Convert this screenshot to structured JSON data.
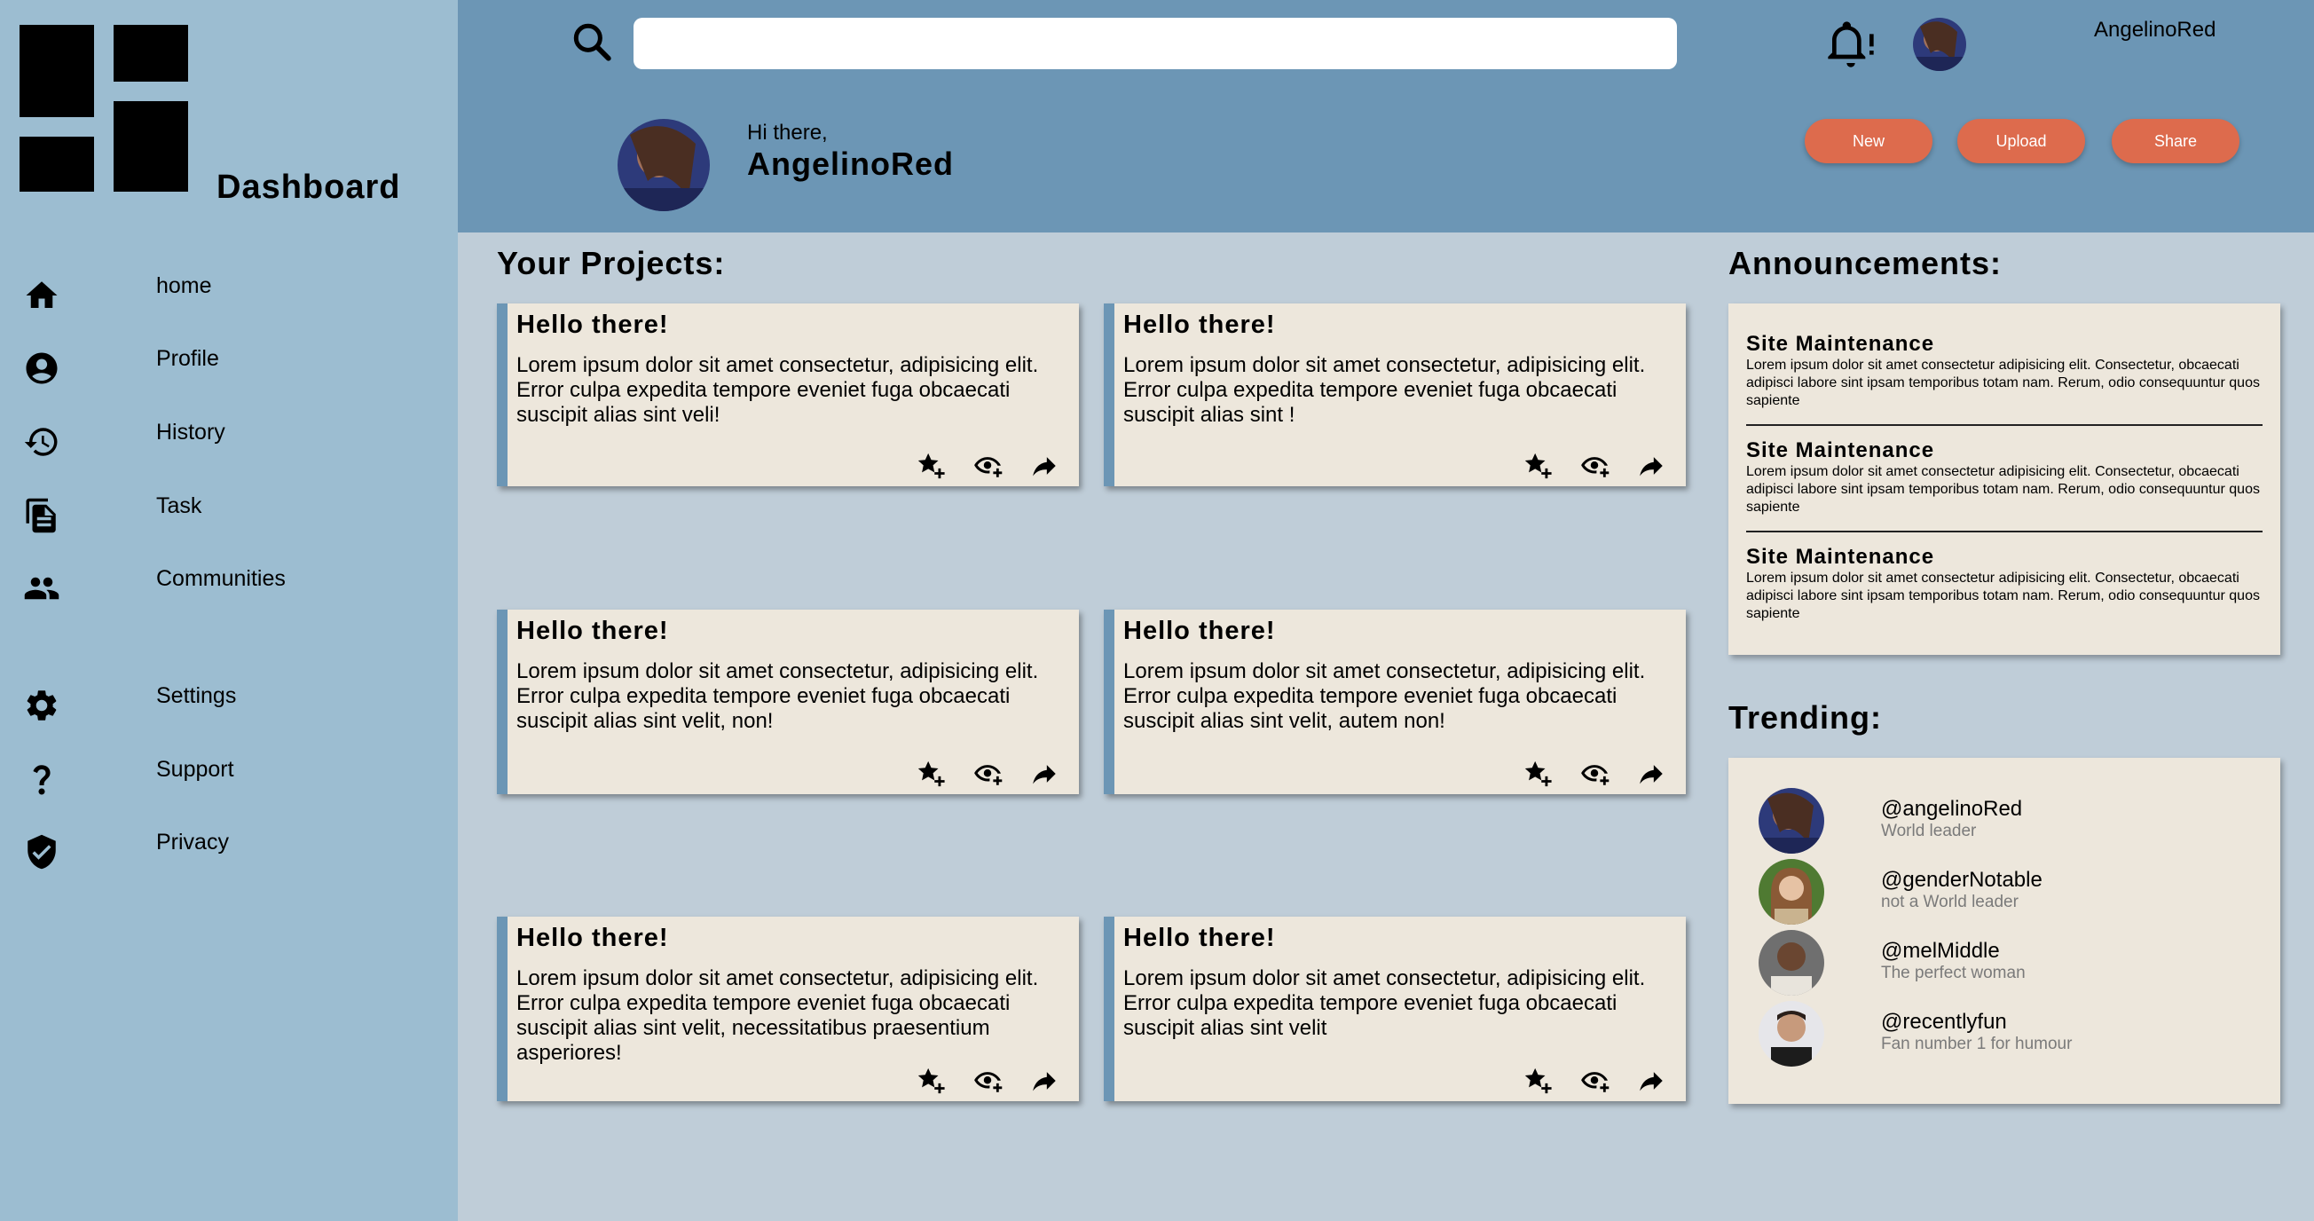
{
  "sidebar": {
    "brand": "Dashboard",
    "items": [
      {
        "label": "home",
        "icon": "home-icon"
      },
      {
        "label": "Profile",
        "icon": "profile-icon"
      },
      {
        "label": "History",
        "icon": "history-icon"
      },
      {
        "label": "Task",
        "icon": "task-icon"
      },
      {
        "label": "Communities",
        "icon": "communities-icon"
      },
      {
        "label": "Settings",
        "icon": "settings-icon"
      },
      {
        "label": "Support",
        "icon": "help-icon"
      },
      {
        "label": "Privacy",
        "icon": "shield-icon"
      }
    ]
  },
  "header": {
    "search_placeholder": "",
    "username": "AngelinoRed",
    "greeting": "Hi there,",
    "greeting_name": "AngelinoRed",
    "buttons": {
      "new": "New",
      "upload": "Upload",
      "share": "Share"
    }
  },
  "projects": {
    "title": "Your Projects:",
    "cards": [
      {
        "title": "Hello there!",
        "body": "Lorem ipsum dolor sit amet consectetur, adipisicing elit. Error culpa expedita tempore eveniet fuga obcaecati suscipit alias sint veli!"
      },
      {
        "title": "Hello there!",
        "body": "Lorem ipsum dolor sit amet consectetur, adipisicing elit. Error culpa expedita tempore eveniet fuga obcaecati suscipit alias sint !"
      },
      {
        "title": "Hello there!",
        "body": "Lorem ipsum dolor sit amet consectetur, adipisicing elit. Error culpa expedita tempore eveniet fuga obcaecati suscipit alias sint velit, non!"
      },
      {
        "title": "Hello there!",
        "body": "Lorem ipsum dolor sit amet consectetur, adipisicing elit. Error culpa expedita tempore eveniet fuga obcaecati suscipit alias sint velit, autem non!"
      },
      {
        "title": "Hello there!",
        "body": "Lorem ipsum dolor sit amet consectetur, adipisicing elit. Error culpa expedita tempore eveniet fuga obcaecati suscipit alias sint velit, necessitatibus praesentium asperiores!"
      },
      {
        "title": "Hello there!",
        "body": "Lorem ipsum dolor sit amet consectetur, adipisicing elit. Error culpa expedita tempore eveniet fuga obcaecati suscipit alias sint velit"
      }
    ]
  },
  "announcements": {
    "title": "Announcements:",
    "items": [
      {
        "title": "Site Maintenance",
        "body": "Lorem ipsum dolor sit amet consectetur adipisicing elit. Consectetur, obcaecati adipisci labore sint ipsam temporibus totam nam. Rerum, odio consequuntur quos sapiente"
      },
      {
        "title": "Site Maintenance",
        "body": "Lorem ipsum dolor sit amet consectetur adipisicing elit. Consectetur, obcaecati adipisci labore sint ipsam temporibus totam nam. Rerum, odio consequuntur quos sapiente"
      },
      {
        "title": "Site Maintenance",
        "body": "Lorem ipsum dolor sit amet consectetur adipisicing elit. Consectetur, obcaecati adipisci labore sint ipsam temporibus totam nam. Rerum, odio consequuntur quos sapiente"
      }
    ]
  },
  "trending": {
    "title": "Trending:",
    "users": [
      {
        "handle": "@angelinoRed",
        "subtitle": "World leader"
      },
      {
        "handle": "@genderNotable",
        "subtitle": "not a World leader"
      },
      {
        "handle": "@melMiddle",
        "subtitle": "The perfect woman"
      },
      {
        "handle": "@recentlyfun",
        "subtitle": "Fan number 1 for humour"
      }
    ]
  },
  "colors": {
    "sidebar_bg": "#9cbdd1",
    "header_bg": "#6c96b5",
    "page_bg": "#bfcdd8",
    "card_bg": "#ede7dc",
    "accent_button": "#dd6b4d"
  }
}
